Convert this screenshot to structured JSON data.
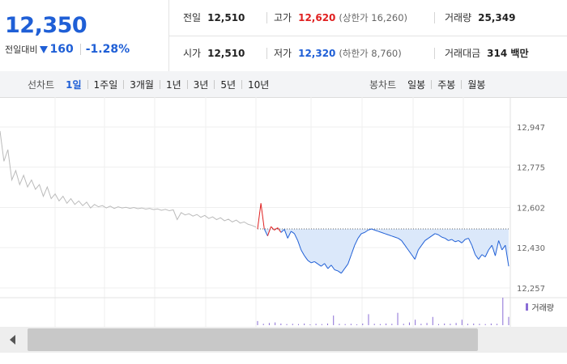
{
  "quote": {
    "price": "12,350",
    "change_label": "전일대비",
    "change_amount": "160",
    "change_rate": "-1.28%",
    "prev_close": {
      "label": "전일",
      "value": "12,510"
    },
    "high": {
      "label": "고가",
      "value": "12,620",
      "sub": "(상한가 16,260)"
    },
    "volume": {
      "label": "거래량",
      "value": "25,349"
    },
    "open": {
      "label": "시가",
      "value": "12,510"
    },
    "low": {
      "label": "저가",
      "value": "12,320",
      "sub": "(하한가 8,760)"
    },
    "trade_value": {
      "label": "거래대금",
      "value": "314 백만"
    }
  },
  "line_tabs": {
    "title": "선차트",
    "items": [
      "1일",
      "1주일",
      "3개월",
      "1년",
      "3년",
      "5년",
      "10년"
    ],
    "active": "1일"
  },
  "candle_tabs": {
    "title": "봉차트",
    "items": [
      "일봉",
      "주봉",
      "월봉"
    ]
  },
  "chart": {
    "yticks": [
      "12,947",
      "12,775",
      "12,602",
      "12,430",
      "12,257"
    ],
    "volume_legend": "거래량"
  },
  "colors": {
    "up": "#e02020",
    "down": "#1f5fd6",
    "prev_day_line": "#bbbbbb",
    "fill": "#dbe8fa",
    "volume": "#8a6dd6"
  },
  "chart_data": {
    "type": "line",
    "ylim": [
      12257,
      12947
    ],
    "yticks": [
      12947,
      12775,
      12602,
      12430,
      12257
    ],
    "prev_close": 12510,
    "series": [
      {
        "values": [
          12930,
          12800,
          12850,
          12720,
          12760,
          12700,
          12740,
          12690,
          12720,
          12680,
          12700,
          12650,
          12690,
          12640,
          12660,
          12630,
          12650,
          12620,
          12640,
          12615,
          12630,
          12610,
          12625,
          12600,
          12615,
          12605,
          12610,
          12600,
          12608,
          12598,
          12605,
          12600,
          12603,
          12598,
          12602,
          12597,
          12600,
          12595,
          12598,
          12593,
          12596,
          12590,
          12594,
          12588,
          12592,
          12550,
          12580,
          12570,
          12575,
          12565,
          12572,
          12560,
          12568,
          12555,
          12562,
          12550,
          12558,
          12545,
          12552,
          12540,
          12548,
          12535,
          12540,
          12530,
          12525,
          12518
        ]
      },
      {
        "values": [
          12510,
          12620,
          12510,
          12480,
          12520,
          12505,
          12515,
          12495,
          12508,
          12470,
          12500,
          12490,
          12460,
          12420,
          12395,
          12375,
          12365,
          12370,
          12360,
          12350,
          12362,
          12340,
          12355,
          12335,
          12330,
          12320,
          12340,
          12360,
          12400,
          12440,
          12470,
          12490,
          12495,
          12505,
          12510,
          12505,
          12500,
          12495,
          12490,
          12485,
          12480,
          12475,
          12470,
          12460,
          12440,
          12420,
          12400,
          12380,
          12420,
          12440,
          12460,
          12470,
          12480,
          12490,
          12485,
          12475,
          12470,
          12460,
          12465,
          12455,
          12460,
          12450,
          12465,
          12470,
          12440,
          12400,
          12380,
          12400,
          12390,
          12420,
          12440,
          12395,
          12460,
          12420,
          12440,
          12350
        ]
      }
    ],
    "volume": [
      0.15,
      0.05,
      0.08,
      0.1,
      0.06,
      0.04,
      0.05,
      0.04,
      0.06,
      0.03,
      0.05,
      0.04,
      0.06,
      0.35,
      0.05,
      0.04,
      0.05,
      0.03,
      0.06,
      0.4,
      0.05,
      0.04,
      0.06,
      0.05,
      0.45,
      0.05,
      0.1,
      0.2,
      0.05,
      0.08,
      0.3,
      0.04,
      0.06,
      0.05,
      0.08,
      0.2,
      0.05,
      0.06,
      0.05,
      0.04,
      0.06,
      0.05,
      1.0,
      0.3
    ]
  }
}
